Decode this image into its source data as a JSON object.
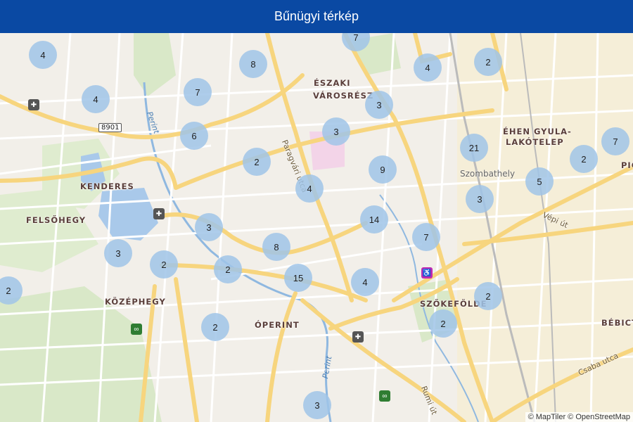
{
  "header": {
    "title": "Bűnügyi térkép"
  },
  "map": {
    "places": [
      {
        "text": "ÉSZAKI"
      },
      {
        "text": "VÁROSRÉSZ"
      },
      {
        "text": "ÉHEN GYULA-"
      },
      {
        "text": "LAKÓTELEP"
      },
      {
        "text": "KENDERES"
      },
      {
        "text": "FELSŐHEGY"
      },
      {
        "text": "KÖZÉPHEGY"
      },
      {
        "text": "ÓPERINT"
      },
      {
        "text": "SZŐKEFÖLDE"
      },
      {
        "text": "BÉBICT"
      },
      {
        "text": "PIC"
      }
    ],
    "city": "Szombathely",
    "roads": [
      "Paragvári utca",
      "Vépi út",
      "Rumi út",
      "Csaba utca"
    ],
    "water": [
      "Perint",
      "Perint"
    ],
    "road_number": "8901",
    "clusters": [
      "7",
      "4",
      "8",
      "4",
      "2",
      "4",
      "7",
      "3",
      "6",
      "3",
      "21",
      "7",
      "2",
      "2",
      "9",
      "5",
      "4",
      "3",
      "3",
      "14",
      "7",
      "3",
      "8",
      "2",
      "2",
      "15",
      "4",
      "2",
      "2",
      "2",
      "2",
      "3"
    ]
  },
  "attribution": "© MapTiler © OpenStreetMap"
}
